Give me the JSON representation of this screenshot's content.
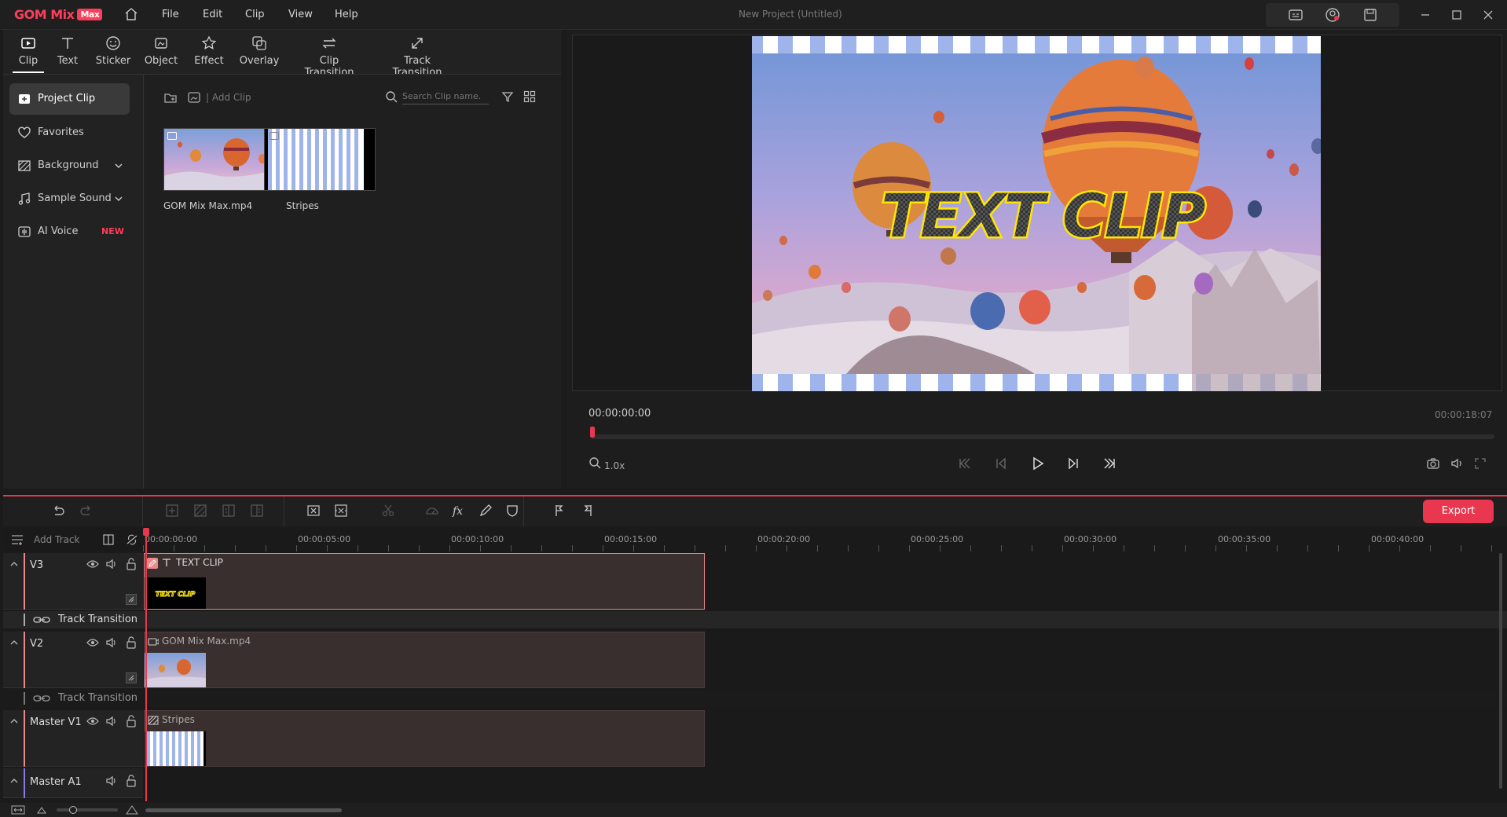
{
  "app": {
    "logo": "GOM Mix",
    "logo_badge": "Max",
    "title": "New Project (Untitled)"
  },
  "menu": [
    "File",
    "Edit",
    "Clip",
    "View",
    "Help"
  ],
  "category_tabs": [
    {
      "label": "Clip",
      "icon": "clip-icon",
      "active": true
    },
    {
      "label": "Text",
      "icon": "text-icon"
    },
    {
      "label": "Sticker",
      "icon": "sticker-icon"
    },
    {
      "label": "Object",
      "icon": "object-icon"
    },
    {
      "label": "Effect",
      "icon": "effect-icon"
    },
    {
      "label": "Overlay",
      "icon": "overlay-icon"
    },
    {
      "label": "Clip Transition",
      "icon": "clip-transition-icon"
    },
    {
      "label": "Track Transition",
      "icon": "track-transition-icon"
    }
  ],
  "sidebar": {
    "items": [
      {
        "label": "Project Clip",
        "icon": "project-clip-icon",
        "active": true
      },
      {
        "label": "Favorites",
        "icon": "heart-icon"
      },
      {
        "label": "Background",
        "icon": "background-icon"
      },
      {
        "label": "Sample Sound",
        "icon": "music-note-icon"
      },
      {
        "label": "AI Voice",
        "icon": "ai-voice-icon",
        "badge": "NEW"
      }
    ]
  },
  "clip_panel": {
    "add_clip": "| Add Clip",
    "search_placeholder": "Search Clip name.",
    "clips": [
      {
        "name": "GOM Mix Max.mp4"
      },
      {
        "name": "Stripes"
      }
    ]
  },
  "preview": {
    "overlay_text": "TEXT CLIP",
    "current_time": "00:00:00:00",
    "end_time": "00:00:18:07",
    "zoom": "1.0x"
  },
  "timeline": {
    "add_track": "Add Track",
    "export_label": "Export",
    "ruler": [
      "00:00:00:00",
      "00:00:05:00",
      "00:00:10:00",
      "00:00:15:00",
      "00:00:20:00",
      "00:00:25:00",
      "00:00:30:00",
      "00:00:35:00",
      "00:00:40:00"
    ],
    "track_transition": "Track Transition",
    "tracks": [
      {
        "name": "V3",
        "clip": "TEXT CLIP"
      },
      {
        "name": "V2",
        "clip": "GOM Mix Max.mp4"
      },
      {
        "name": "Master V1",
        "clip": "Stripes"
      },
      {
        "name": "Master A1",
        "clip": ""
      }
    ],
    "mini_text": "TEXT CLIP"
  },
  "colors": {
    "accent": "#e8374f",
    "brand": "#ff3d5a",
    "clip_bg": "#3a2f2f"
  }
}
